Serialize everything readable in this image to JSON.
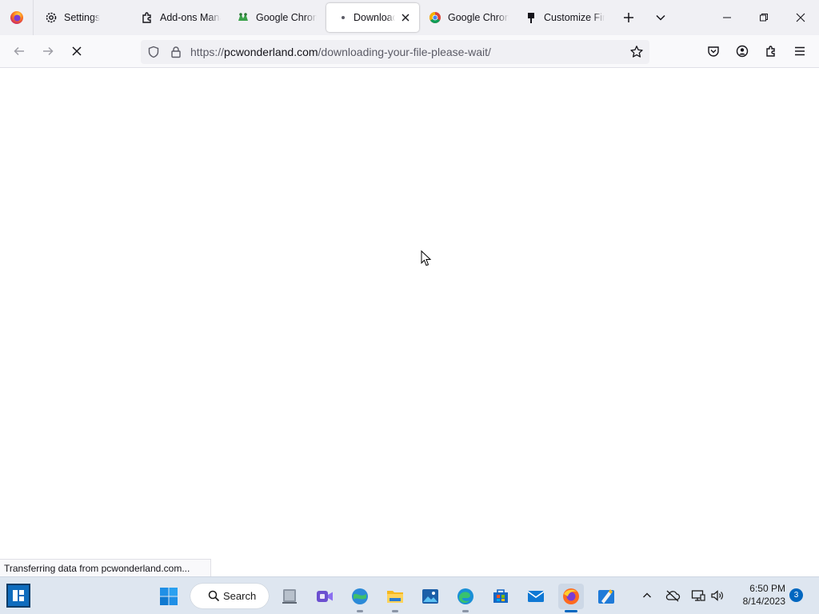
{
  "browser": {
    "tabs": [
      {
        "label": "Settings",
        "icon": "gear-icon",
        "active": false
      },
      {
        "label": "Add-ons Manager",
        "icon": "puzzle-icon",
        "active": false
      },
      {
        "label": "Google Chrome",
        "icon": "frog-icon",
        "active": false
      },
      {
        "label": "Downloading",
        "icon": "dot-icon",
        "active": true
      },
      {
        "label": "Google Chrome",
        "icon": "chrome-icon",
        "active": false
      },
      {
        "label": "Customize Firefox",
        "icon": "pin-icon",
        "active": false
      }
    ],
    "url_prefix": "https://",
    "url_host": "pcwonderland.com",
    "url_path": "/downloading-your-file-please-wait/",
    "status_text": "Transferring data from pcwonderland.com..."
  },
  "taskbar": {
    "search_label": "Search",
    "time": "6:50 PM",
    "date": "8/14/2023",
    "notification_count": "3"
  },
  "colors": {
    "accent": "#0067c0",
    "tab_strip": "#f0f0f4",
    "toolbar": "#f9f9fb",
    "taskbar": "#dee6f0"
  }
}
